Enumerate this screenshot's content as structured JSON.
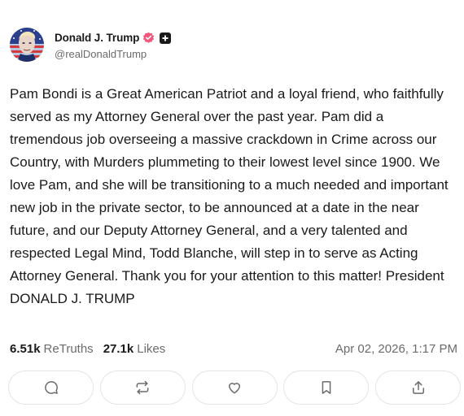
{
  "author": {
    "display_name": "Donald J. Trump",
    "handle": "@realDonaldTrump",
    "avatar_icon": "avatar-flag-portrait",
    "verified_color": "#f0577a"
  },
  "post": {
    "text": "Pam Bondi is a Great American Patriot and a loyal friend, who faithfully served as my Attorney General over the past year. Pam did a tremendous job overseeing a massive crackdown in Crime across our Country, with Murders plummeting to their lowest level since 1900. We love Pam, and she will be transitioning to a much needed and important new job in the private sector, to be announced at a date in the near future, and our Deputy Attorney General, and a very talented and respected Legal Mind, Todd Blanche, will step in to serve as Acting Attorney General. Thank you for your attention to this matter! President DONALD J. TRUMP"
  },
  "stats": {
    "retruths_count": "6.51k",
    "retruths_label": "ReTruths",
    "likes_count": "27.1k",
    "likes_label": "Likes",
    "timestamp": "Apr 02, 2026, 1:17 PM"
  },
  "actions": [
    {
      "name": "reply",
      "icon": "comment-icon"
    },
    {
      "name": "retruth",
      "icon": "repost-icon"
    },
    {
      "name": "like",
      "icon": "heart-icon"
    },
    {
      "name": "bookmark",
      "icon": "bookmark-icon"
    },
    {
      "name": "share",
      "icon": "share-icon"
    }
  ]
}
